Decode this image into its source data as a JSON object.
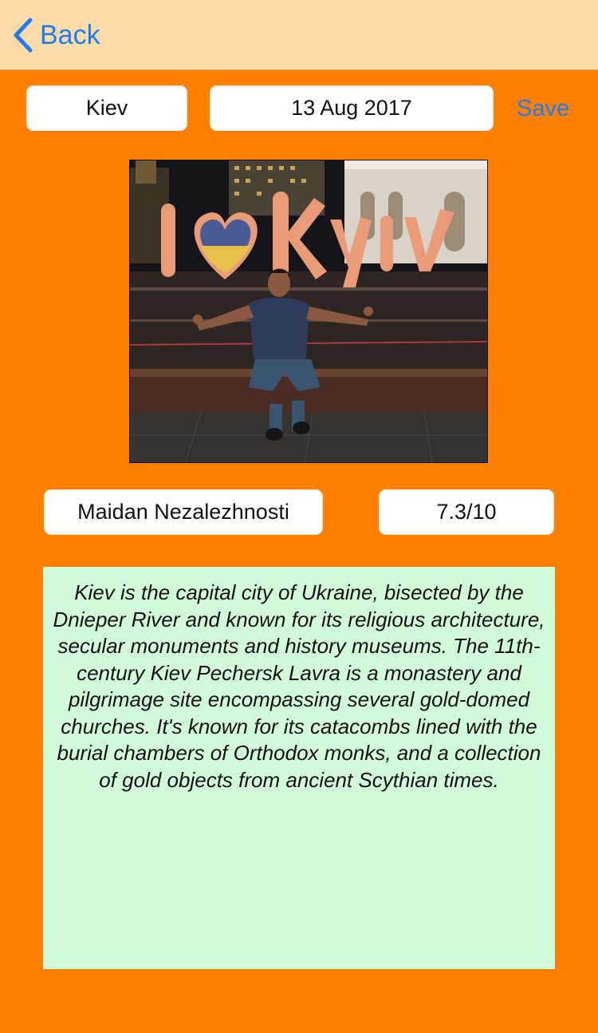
{
  "navbar": {
    "back_label": "Back",
    "back_icon": "chevron-left-icon",
    "accent_color": "#1f7cf4",
    "background_color": "#fedcaa"
  },
  "header_row": {
    "city": "Kiev",
    "date": "13 Aug 2017",
    "save_label": "Save"
  },
  "photo": {
    "sign_text": "I ♥ Kyiv"
  },
  "details_row": {
    "place": "Maidan Nezalezhnosti",
    "rating": "7.3/10"
  },
  "description": {
    "text": "Kiev is the capital city of Ukraine, bisected by the Dnieper River and known for its religious architecture, secular monuments and history museums. The 11th-century Kiev Pechersk Lavra is a monastery and pilgrimage site encompassing several gold-domed churches. It's known for its catacombs lined with the burial chambers of Orthodox monks, and a collection of gold objects from ancient Scythian times.",
    "background_color": "#d2fcd9"
  },
  "page": {
    "background_color": "#ff8000"
  }
}
